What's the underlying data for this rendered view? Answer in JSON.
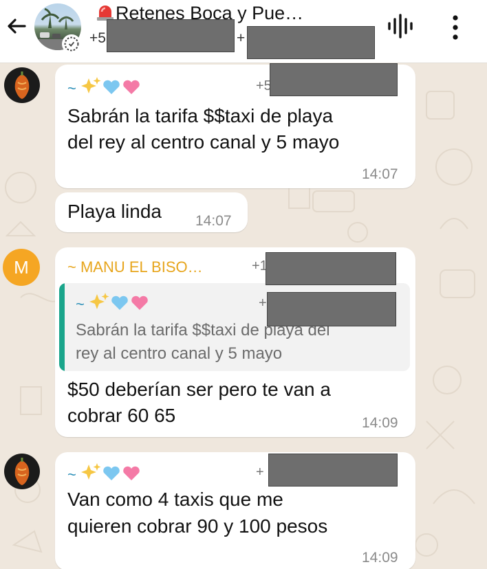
{
  "header": {
    "title": "Retenes Boca y Pue…",
    "subtitle_left": "+5",
    "subtitle_right": "+"
  },
  "messages": [
    {
      "sender_prefix": "~",
      "phone": "+5",
      "text_line1": "Sabrán la tarifa $$taxi de playa",
      "text_line2": "del rey al centro canal y 5 mayo",
      "time": "14:07"
    },
    {
      "text": "Playa linda",
      "time": "14:07"
    },
    {
      "avatar_letter": "M",
      "sender": "~ MANU EL BISO…",
      "phone": "+1",
      "quote": {
        "sender_prefix": "~",
        "phone": "+",
        "text_line1": "Sabrán la tarifa $$taxi de playa del",
        "text_line2": "rey al centro canal y 5 mayo"
      },
      "text_line1": "$50 deberían ser pero te van a",
      "text_line2": "cobrar 60 65",
      "time": "14:09"
    },
    {
      "sender_prefix": "~",
      "phone": "+",
      "text_line1": "Van como 4 taxis que me",
      "text_line2": "quieren cobrar 90 y 100 pesos",
      "time": "14:09"
    }
  ],
  "colors": {
    "background": "#efe7dd",
    "bubble": "#ffffff",
    "sender_blue": "#2c8fb8",
    "sender_orange": "#e7a51c",
    "quote_bar": "#1aa58b",
    "avatar_orange": "#f5a623"
  },
  "icons": [
    "back-arrow-icon",
    "siren-icon",
    "status-ring-icon",
    "voice-call-icon",
    "more-vert-icon",
    "sparkles-icon",
    "blue-heart-icon",
    "pink-heart-icon"
  ]
}
